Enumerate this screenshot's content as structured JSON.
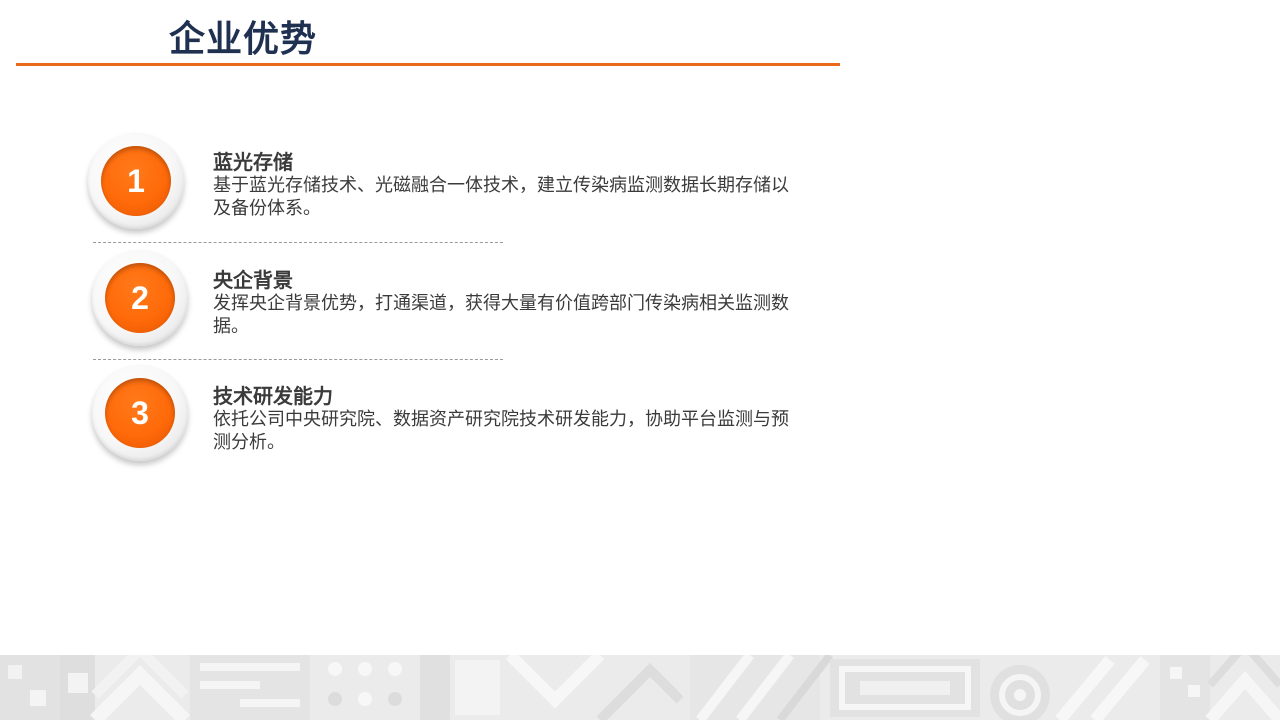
{
  "header": {
    "title": "企业优势"
  },
  "items": [
    {
      "number": "1",
      "heading": "蓝光存储",
      "description": "基于蓝光存储技术、光磁融合一体技术，建立传染病监测数据长期存储以及备份体系。"
    },
    {
      "number": "2",
      "heading": "央企背景",
      "description": "发挥央企背景优势，打通渠道，获得大量有价值跨部门传染病相关监测数据。"
    },
    {
      "number": "3",
      "heading": "技术研发能力",
      "description": "依托公司中央研究院、数据资产研究院技术研发能力，协助平台监测与预测分析。"
    }
  ],
  "colors": {
    "accent": "#ea6a1b",
    "badge_orange": "#ff6a0a",
    "title": "#1f3050",
    "text": "#3b3b3b"
  }
}
